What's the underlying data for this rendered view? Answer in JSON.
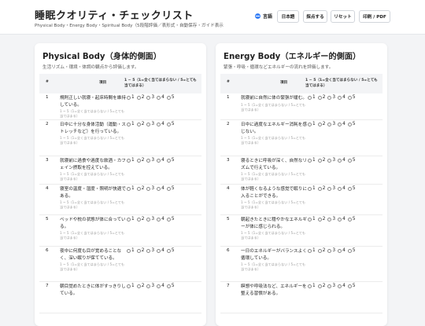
{
  "header": {
    "title": "睡眠クオリティ・チェックリスト",
    "subtitle": "Physical Body・Energy Body・Spiritual Body（5段階評価／表形式・自動保存・ガイド表示",
    "lang_label": "言語",
    "buttons": {
      "japanese": "日本語",
      "score": "採点する",
      "reset": "リセット",
      "print": "印刷 / PDF"
    }
  },
  "panels": [
    {
      "title": "Physical Body（身体的側面）",
      "desc": "生活リズム・環境・体調の観点から評価します。",
      "header": {
        "num": "#",
        "item": "項目",
        "scale": "1 ~ 5（1=全く当てはまらない / 5=とても当てはまる）"
      },
      "rows": [
        {
          "num": "1",
          "text": "規則正しい就寝・起床時間を維持している。",
          "hint": "1 ~ 5（1=全く当てはまらない / 5=とても当てはまる）"
        },
        {
          "num": "2",
          "text": "日中に十分な身体活動（運動・ストレッチなど）を行っている。",
          "hint": "1 ~ 5（1=全く当てはまらない / 5=とても当てはまる）"
        },
        {
          "num": "3",
          "text": "就寝前に過食や過度な飲酒・カフェイン摂取を控えている。",
          "hint": "1 ~ 5（1=全く当てはまらない / 5=とても当てはまる）"
        },
        {
          "num": "4",
          "text": "寝室の温度・湿度・照明が快適である。",
          "hint": "1 ~ 5（1=全く当てはまらない / 5=とても当てはまる）"
        },
        {
          "num": "5",
          "text": "ベッドや枕の状態が体に合っている。",
          "hint": "1 ~ 5（1=全く当てはまらない / 5=とても当てはまる）"
        },
        {
          "num": "6",
          "text": "夜中に何度も目が覚めることなく、深い眠りが保てている。",
          "hint": "1 ~ 5（1=全く当てはまらない / 5=とても当てはまる）"
        },
        {
          "num": "7",
          "text": "朝目覚めたときに体がすっきりしている。",
          "hint": ""
        }
      ]
    },
    {
      "title": "Energy Body（エネルギー的側面）",
      "desc": "緊張・呼吸・循環などエネルギーの流れを評価します。",
      "header": {
        "num": "#",
        "item": "項目",
        "scale": "1 ~ 5（1=全く当てはまらない / 5=とても当てはまる）"
      },
      "rows": [
        {
          "num": "1",
          "text": "就寝前に自然に体の緊張が緩む。",
          "hint": "1 ~ 5（1=全く当てはまらない / 5=とても当てはまる）"
        },
        {
          "num": "2",
          "text": "日中に過度なエネルギー消耗を感じない。",
          "hint": "1 ~ 5（1=全く当てはまらない / 5=とても当てはまる）"
        },
        {
          "num": "3",
          "text": "寝るときに呼吸が深く、自然なリズムで行えている。",
          "hint": "1 ~ 5（1=全く当てはまらない / 5=とても当てはまる）"
        },
        {
          "num": "4",
          "text": "体が軽くなるような感覚で眠りに入ることができる。",
          "hint": "1 ~ 5（1=全く当てはまらない / 5=とても当てはまる）"
        },
        {
          "num": "5",
          "text": "朝起きたときに穏やかなエネルギーが体に感じられる。",
          "hint": "1 ~ 5（1=全く当てはまらない / 5=とても当てはまる）"
        },
        {
          "num": "6",
          "text": "一日のエネルギーがバランスよく循環している。",
          "hint": "1 ~ 5（1=全く当てはまらない / 5=とても当てはまる）"
        },
        {
          "num": "7",
          "text": "瞑想や呼吸法など、エネルギーを整える習慣がある。",
          "hint": ""
        }
      ]
    }
  ],
  "scale_options": [
    "1",
    "2",
    "3",
    "4",
    "5"
  ]
}
